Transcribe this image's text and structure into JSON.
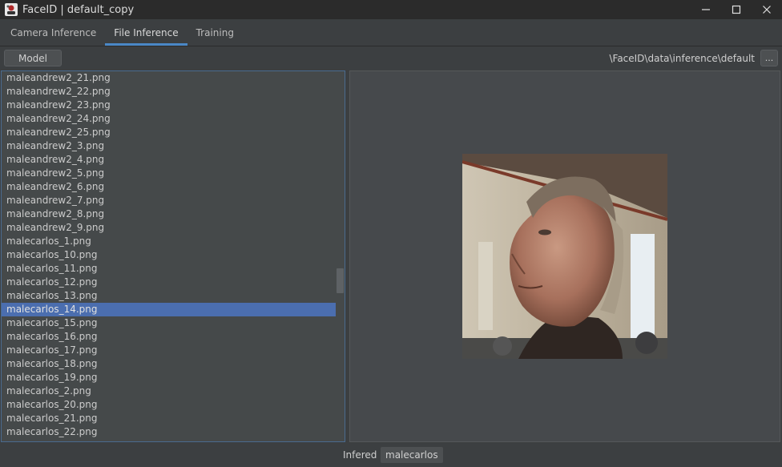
{
  "window": {
    "title": "FaceID | default_copy",
    "icon": "faceid-app-icon",
    "controls": [
      "minimize-icon",
      "maximize-icon",
      "close-icon"
    ]
  },
  "tabs": [
    {
      "label": "Camera Inference",
      "active": false
    },
    {
      "label": "File Inference",
      "active": true
    },
    {
      "label": "Training",
      "active": false
    }
  ],
  "toolbar": {
    "model_label": "Model",
    "path": "\\FaceID\\data\\inference\\default",
    "browse_label": "..."
  },
  "file_list": {
    "items": [
      "maleandrew2_21.png",
      "maleandrew2_22.png",
      "maleandrew2_23.png",
      "maleandrew2_24.png",
      "maleandrew2_25.png",
      "maleandrew2_3.png",
      "maleandrew2_4.png",
      "maleandrew2_5.png",
      "maleandrew2_6.png",
      "maleandrew2_7.png",
      "maleandrew2_8.png",
      "maleandrew2_9.png",
      "malecarlos_1.png",
      "malecarlos_10.png",
      "malecarlos_11.png",
      "malecarlos_12.png",
      "malecarlos_13.png",
      "malecarlos_14.png",
      "malecarlos_15.png",
      "malecarlos_16.png",
      "malecarlos_17.png",
      "malecarlos_18.png",
      "malecarlos_19.png",
      "malecarlos_2.png",
      "malecarlos_20.png",
      "malecarlos_21.png",
      "malecarlos_22.png"
    ],
    "selected": "malecarlos_14.png"
  },
  "status": {
    "label": "Infered",
    "value": "malecarlos"
  },
  "colors": {
    "accent": "#4a88c7",
    "selection": "#4b6eaf",
    "background": "#3c3f41",
    "titlebar": "#2b2b2b"
  }
}
